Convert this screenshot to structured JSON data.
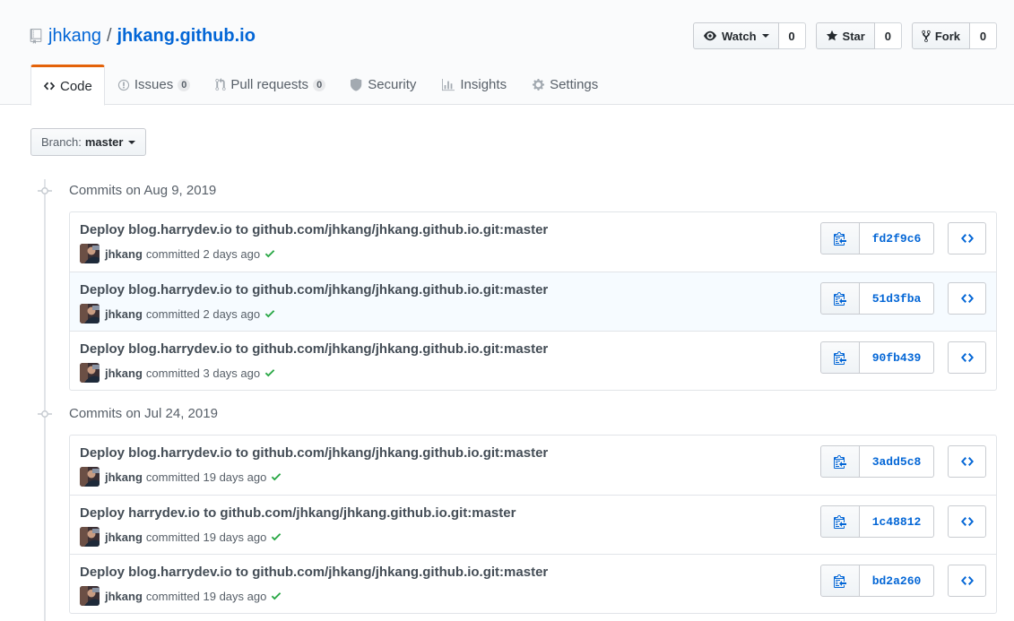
{
  "repo": {
    "owner": "jhkang",
    "separator": "/",
    "name": "jhkang.github.io"
  },
  "actions": {
    "watch": {
      "label": "Watch",
      "count": "0"
    },
    "star": {
      "label": "Star",
      "count": "0"
    },
    "fork": {
      "label": "Fork",
      "count": "0"
    }
  },
  "tabs": [
    {
      "label": "Code",
      "icon": "code-icon",
      "selected": true
    },
    {
      "label": "Issues",
      "icon": "issue-icon",
      "counter": "0"
    },
    {
      "label": "Pull requests",
      "icon": "pull-request-icon",
      "counter": "0"
    },
    {
      "label": "Security",
      "icon": "shield-icon"
    },
    {
      "label": "Insights",
      "icon": "graph-icon"
    },
    {
      "label": "Settings",
      "icon": "gear-icon"
    }
  ],
  "branch": {
    "prefix": "Branch:",
    "name": "master"
  },
  "groups": [
    {
      "header": "Commits on Aug 9, 2019",
      "commits": [
        {
          "message": "Deploy blog.harrydev.io to github.com/jhkang/jhkang.github.io.git:master",
          "author": "jhkang",
          "verb": "committed",
          "time": "2 days ago",
          "sha": "fd2f9c6"
        },
        {
          "message": "Deploy blog.harrydev.io to github.com/jhkang/jhkang.github.io.git:master",
          "author": "jhkang",
          "verb": "committed",
          "time": "2 days ago",
          "sha": "51d3fba"
        },
        {
          "message": "Deploy blog.harrydev.io to github.com/jhkang/jhkang.github.io.git:master",
          "author": "jhkang",
          "verb": "committed",
          "time": "3 days ago",
          "sha": "90fb439"
        }
      ]
    },
    {
      "header": "Commits on Jul 24, 2019",
      "commits": [
        {
          "message": "Deploy blog.harrydev.io to github.com/jhkang/jhkang.github.io.git:master",
          "author": "jhkang",
          "verb": "committed",
          "time": "19 days ago",
          "sha": "3add5c8"
        },
        {
          "message": "Deploy harrydev.io to github.com/jhkang/jhkang.github.io.git:master",
          "author": "jhkang",
          "verb": "committed",
          "time": "19 days ago",
          "sha": "1c48812"
        },
        {
          "message": "Deploy blog.harrydev.io to github.com/jhkang/jhkang.github.io.git:master",
          "author": "jhkang",
          "verb": "committed",
          "time": "19 days ago",
          "sha": "bd2a260"
        }
      ]
    }
  ],
  "colors": {
    "link": "#0366d6",
    "tab_accent": "#e36209",
    "success": "#28a745",
    "highlight_row": "#f6fbff"
  }
}
